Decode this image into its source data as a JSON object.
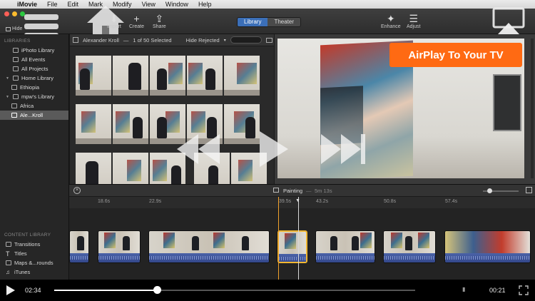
{
  "menubar": {
    "apple": "",
    "items": [
      "iMovie",
      "File",
      "Edit",
      "Mark",
      "Modify",
      "View",
      "Window",
      "Help"
    ]
  },
  "toolbar": {
    "hide_label": "Hide",
    "import_label": "Import",
    "create_label": "Create",
    "share_label": "Share",
    "tab_library": "Library",
    "tab_theater": "Theater",
    "enhance_label": "Enhance",
    "adjust_label": "Adjust"
  },
  "sidebar": {
    "libraries_header": "LIBRARIES",
    "items": [
      {
        "label": "iPhoto Library"
      },
      {
        "label": "All Events"
      },
      {
        "label": "All Projects"
      },
      {
        "label": "Home Library"
      },
      {
        "label": "Ethiopia"
      },
      {
        "label": "mpw's Library"
      },
      {
        "label": "Africa"
      },
      {
        "label": "Ale...Kroll"
      }
    ],
    "content_header": "CONTENT LIBRARY",
    "content_items": [
      {
        "label": "Transitions"
      },
      {
        "label": "Titles"
      },
      {
        "label": "Maps &...rounds"
      },
      {
        "label": "iTunes"
      }
    ]
  },
  "browser": {
    "title": "Alexander Kroll",
    "selection": "1 of 50 Selected",
    "filter": "Hide Rejected"
  },
  "airplay": {
    "banner": "AirPlay To Your TV"
  },
  "timeline": {
    "project_name": "Painting",
    "duration": "5m 13s",
    "ruler": [
      "18.6s",
      "22.9s",
      "39.5s",
      "43.2s",
      "50.8s",
      "57.4s"
    ]
  },
  "playback": {
    "elapsed": "02:34",
    "remaining": "00:21",
    "progress": 0.285
  },
  "colors": {
    "accent_orange": "#ff6a13",
    "selection_blue": "#3b6fb8",
    "playhead": "#f2a22c",
    "clip_selected": "#f2b731"
  }
}
